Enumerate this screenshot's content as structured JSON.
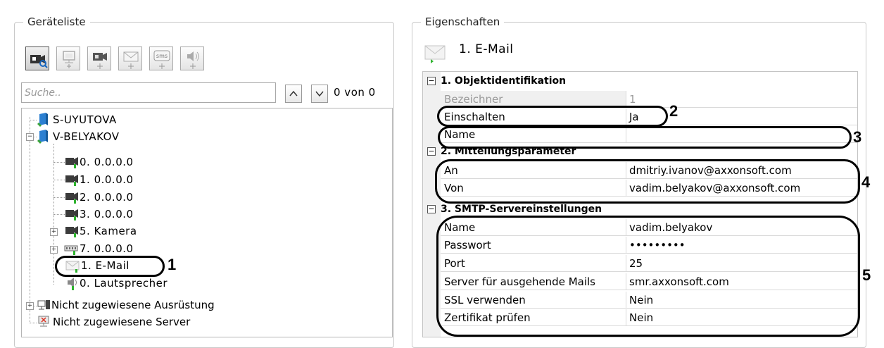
{
  "device_list": {
    "title": "Geräteliste",
    "toolbar": [
      {
        "icon": "camera-search-icon"
      },
      {
        "icon": "add-server-icon"
      },
      {
        "icon": "add-camera-icon"
      },
      {
        "icon": "add-email-icon"
      },
      {
        "icon": "add-sms-icon"
      },
      {
        "icon": "add-speaker-icon"
      }
    ],
    "search": {
      "placeholder": "Suche..",
      "up": "^",
      "down": "v",
      "count": "0 von 0"
    },
    "tree": [
      {
        "label": "S-UYUTOVA",
        "icon": "server-icon"
      },
      {
        "label": "V-BELYAKOV",
        "icon": "server-icon",
        "expander": "−"
      },
      {
        "label": "0. 0.0.0.0",
        "icon": "camera-icon"
      },
      {
        "label": "1. 0.0.0.0",
        "icon": "camera-icon"
      },
      {
        "label": "2. 0.0.0.0",
        "icon": "camera-icon"
      },
      {
        "label": "3. 0.0.0.0",
        "icon": "camera-icon"
      },
      {
        "label": "5. Kamera",
        "icon": "camera-icon",
        "expander": "+"
      },
      {
        "label": "7. 0.0.0.0",
        "icon": "io-board-icon",
        "expander": "+"
      },
      {
        "label": "1. E-Mail",
        "icon": "email-icon"
      },
      {
        "label": "0. Lautsprecher",
        "icon": "speaker-icon"
      },
      {
        "label": "Nicht zugewiesene Ausrüstung",
        "icon": "equipment-icon",
        "expander": "+"
      },
      {
        "label": "Nicht zugewiesene Server",
        "icon": "server-monitor-icon"
      }
    ]
  },
  "properties": {
    "title": "Eigenschaften",
    "object_name": "1. E-Mail",
    "categories": [
      {
        "title": "1. Objektidentifikation",
        "collapse": "−",
        "rows": [
          {
            "key": "Bezeichner",
            "value": "1"
          },
          {
            "key": "Einschalten",
            "value": "Ja"
          },
          {
            "key": "Name",
            "value": ""
          }
        ]
      },
      {
        "title": "2. Mitteilungsparameter",
        "collapse": "−",
        "rows": [
          {
            "key": "An",
            "value": "dmitriy.ivanov@axxonsoft.com"
          },
          {
            "key": "Von",
            "value": "vadim.belyakov@axxonsoft.com"
          }
        ]
      },
      {
        "title": "3. SMTP-Servereinstellungen",
        "collapse": "−",
        "rows": [
          {
            "key": "Name",
            "value": "vadim.belyakov"
          },
          {
            "key": "Passwort",
            "value": "•••••••••"
          },
          {
            "key": "Port",
            "value": "25"
          },
          {
            "key": "Server für ausgehende Mails",
            "value": "smr.axxonsoft.com"
          },
          {
            "key": "SSL verwenden",
            "value": "Nein"
          },
          {
            "key": "Zertifikat prüfen",
            "value": "Nein"
          }
        ]
      }
    ]
  },
  "annotations": [
    "1",
    "2",
    "3",
    "4",
    "5"
  ]
}
